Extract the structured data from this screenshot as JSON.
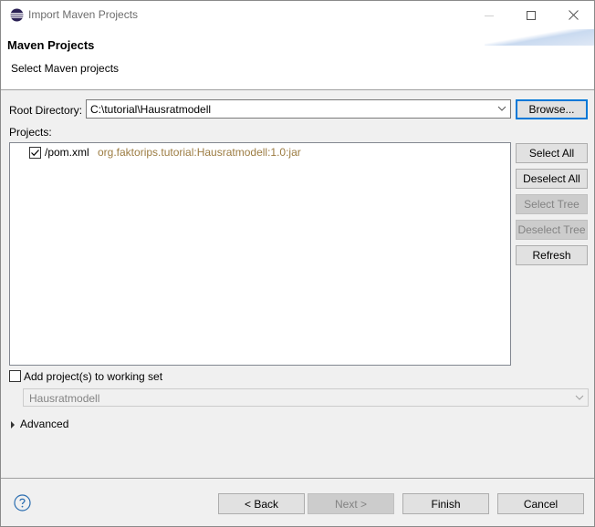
{
  "window": {
    "title": "Import Maven Projects",
    "icons": {
      "app": "eclipse-icon",
      "minimize": "minimize-icon",
      "maximize": "maximize-icon",
      "close": "close-icon"
    }
  },
  "header": {
    "title": "Maven Projects",
    "description": "Select Maven projects"
  },
  "root_directory": {
    "label": "Root Directory:",
    "value": "C:\\tutorial\\Hausratmodell",
    "browse_label": "Browse..."
  },
  "projects": {
    "label": "Projects:",
    "items": [
      {
        "checked": true,
        "name": "/pom.xml",
        "gav": "org.faktorips.tutorial:Hausratmodell:1.0:jar"
      }
    ]
  },
  "side_buttons": {
    "select_all": "Select All",
    "deselect_all": "Deselect All",
    "select_tree": "Select Tree",
    "deselect_tree": "Deselect Tree",
    "refresh": "Refresh"
  },
  "working_set": {
    "checkbox_label": "Add project(s) to working set",
    "checked": false,
    "value": "Hausratmodell"
  },
  "advanced": {
    "label": "Advanced",
    "expanded": false
  },
  "footer": {
    "back": "< Back",
    "next": "Next >",
    "finish": "Finish",
    "cancel": "Cancel",
    "help_icon": "help-icon"
  },
  "colors": {
    "accent": "#0078d7",
    "gav_text": "#9c7c42",
    "disabled_text": "#838383"
  }
}
